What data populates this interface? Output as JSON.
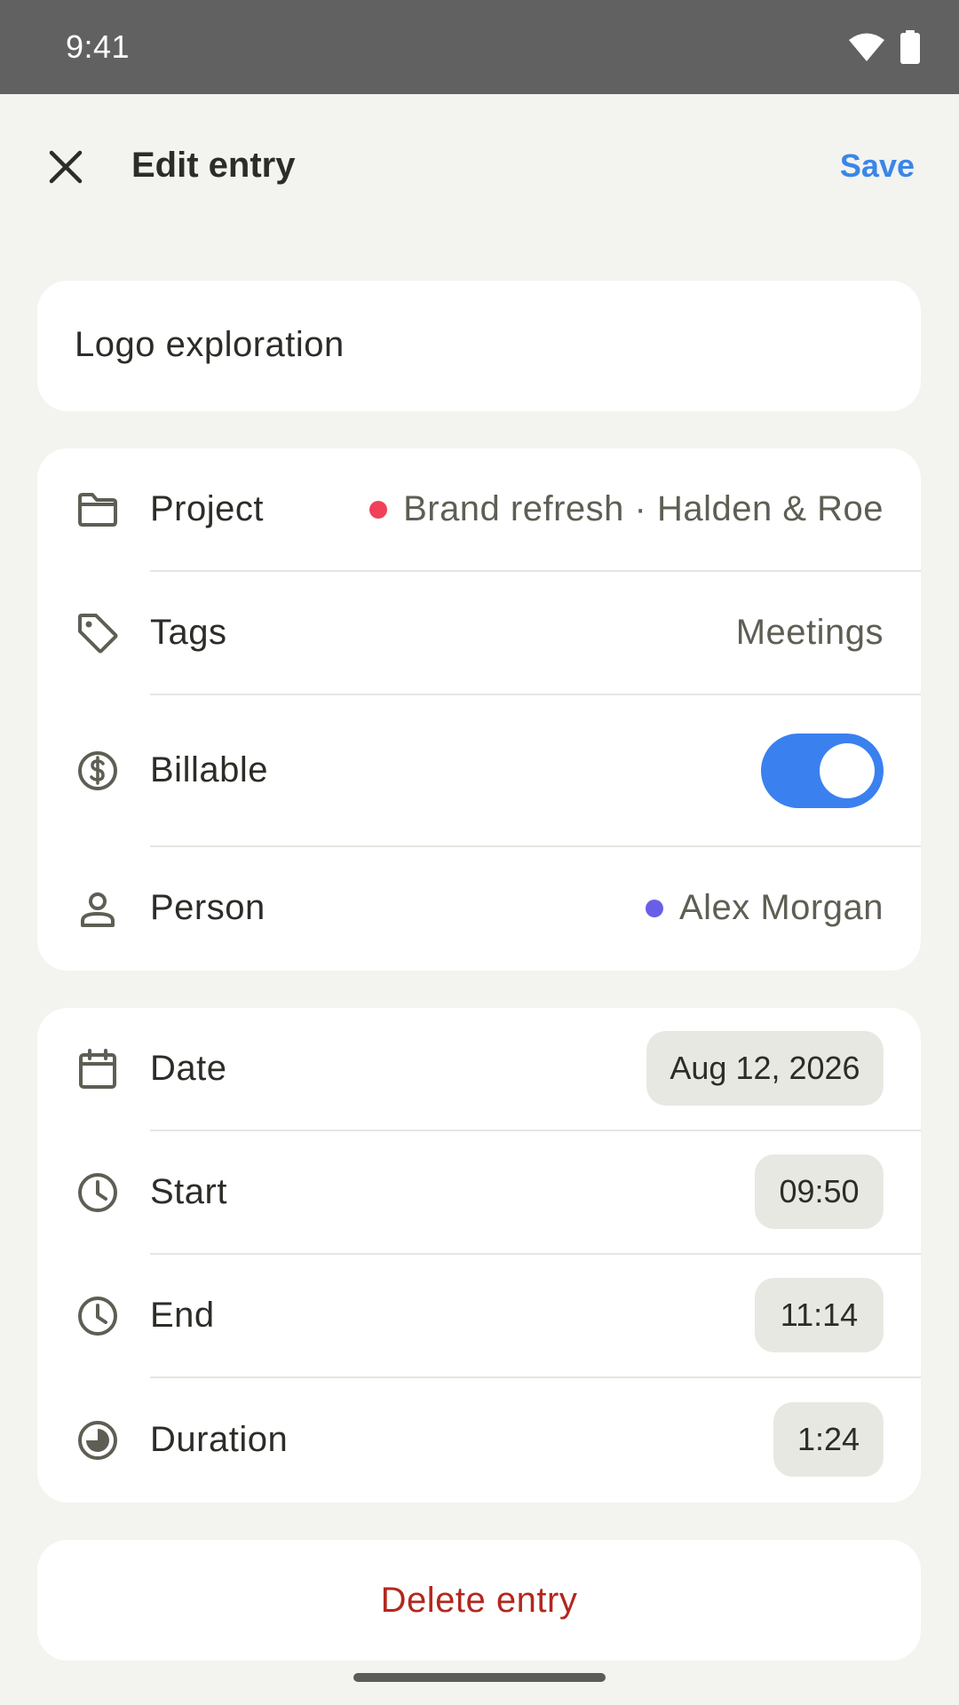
{
  "status_bar": {
    "time": "9:41"
  },
  "app_bar": {
    "title": "Edit entry",
    "save_label": "Save"
  },
  "description": {
    "value": "Logo exploration"
  },
  "meta": {
    "project": {
      "label": "Project",
      "value": "Brand refresh · Halden & Roe",
      "dot_color": "#f0405a"
    },
    "tags": {
      "label": "Tags",
      "value": "Meetings"
    },
    "billable": {
      "label": "Billable",
      "enabled": true
    },
    "person": {
      "label": "Person",
      "value": "Alex Morgan",
      "dot_color": "#6a5ee8"
    }
  },
  "time": {
    "date": {
      "label": "Date",
      "value": "Aug 12, 2026"
    },
    "start": {
      "label": "Start",
      "value": "09:50"
    },
    "end": {
      "label": "End",
      "value": "11:14"
    },
    "duration": {
      "label": "Duration",
      "value": "1:24"
    }
  },
  "delete_label": "Delete entry",
  "colors": {
    "accent": "#3a86e8",
    "danger": "#b3271e",
    "icon": "#5e5e54"
  },
  "icons": [
    "wifi-icon",
    "battery-icon",
    "close-icon",
    "folder-icon",
    "tag-icon",
    "dollar-circle-icon",
    "person-icon",
    "calendar-icon",
    "clock-icon",
    "pie-clock-icon"
  ]
}
